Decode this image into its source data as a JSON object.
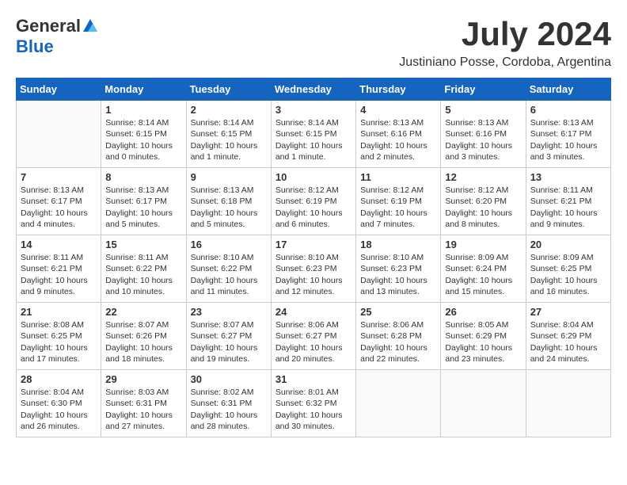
{
  "logo": {
    "general": "General",
    "blue": "Blue"
  },
  "title": {
    "month_year": "July 2024",
    "location": "Justiniano Posse, Cordoba, Argentina"
  },
  "weekdays": [
    "Sunday",
    "Monday",
    "Tuesday",
    "Wednesday",
    "Thursday",
    "Friday",
    "Saturday"
  ],
  "weeks": [
    [
      {
        "day": "",
        "info": ""
      },
      {
        "day": "1",
        "info": "Sunrise: 8:14 AM\nSunset: 6:15 PM\nDaylight: 10 hours\nand 0 minutes."
      },
      {
        "day": "2",
        "info": "Sunrise: 8:14 AM\nSunset: 6:15 PM\nDaylight: 10 hours\nand 1 minute."
      },
      {
        "day": "3",
        "info": "Sunrise: 8:14 AM\nSunset: 6:15 PM\nDaylight: 10 hours\nand 1 minute."
      },
      {
        "day": "4",
        "info": "Sunrise: 8:13 AM\nSunset: 6:16 PM\nDaylight: 10 hours\nand 2 minutes."
      },
      {
        "day": "5",
        "info": "Sunrise: 8:13 AM\nSunset: 6:16 PM\nDaylight: 10 hours\nand 3 minutes."
      },
      {
        "day": "6",
        "info": "Sunrise: 8:13 AM\nSunset: 6:17 PM\nDaylight: 10 hours\nand 3 minutes."
      }
    ],
    [
      {
        "day": "7",
        "info": "Sunrise: 8:13 AM\nSunset: 6:17 PM\nDaylight: 10 hours\nand 4 minutes."
      },
      {
        "day": "8",
        "info": "Sunrise: 8:13 AM\nSunset: 6:17 PM\nDaylight: 10 hours\nand 5 minutes."
      },
      {
        "day": "9",
        "info": "Sunrise: 8:13 AM\nSunset: 6:18 PM\nDaylight: 10 hours\nand 5 minutes."
      },
      {
        "day": "10",
        "info": "Sunrise: 8:12 AM\nSunset: 6:19 PM\nDaylight: 10 hours\nand 6 minutes."
      },
      {
        "day": "11",
        "info": "Sunrise: 8:12 AM\nSunset: 6:19 PM\nDaylight: 10 hours\nand 7 minutes."
      },
      {
        "day": "12",
        "info": "Sunrise: 8:12 AM\nSunset: 6:20 PM\nDaylight: 10 hours\nand 8 minutes."
      },
      {
        "day": "13",
        "info": "Sunrise: 8:11 AM\nSunset: 6:21 PM\nDaylight: 10 hours\nand 9 minutes."
      }
    ],
    [
      {
        "day": "14",
        "info": "Sunrise: 8:11 AM\nSunset: 6:21 PM\nDaylight: 10 hours\nand 9 minutes."
      },
      {
        "day": "15",
        "info": "Sunrise: 8:11 AM\nSunset: 6:22 PM\nDaylight: 10 hours\nand 10 minutes."
      },
      {
        "day": "16",
        "info": "Sunrise: 8:10 AM\nSunset: 6:22 PM\nDaylight: 10 hours\nand 11 minutes."
      },
      {
        "day": "17",
        "info": "Sunrise: 8:10 AM\nSunset: 6:23 PM\nDaylight: 10 hours\nand 12 minutes."
      },
      {
        "day": "18",
        "info": "Sunrise: 8:10 AM\nSunset: 6:23 PM\nDaylight: 10 hours\nand 13 minutes."
      },
      {
        "day": "19",
        "info": "Sunrise: 8:09 AM\nSunset: 6:24 PM\nDaylight: 10 hours\nand 15 minutes."
      },
      {
        "day": "20",
        "info": "Sunrise: 8:09 AM\nSunset: 6:25 PM\nDaylight: 10 hours\nand 16 minutes."
      }
    ],
    [
      {
        "day": "21",
        "info": "Sunrise: 8:08 AM\nSunset: 6:25 PM\nDaylight: 10 hours\nand 17 minutes."
      },
      {
        "day": "22",
        "info": "Sunrise: 8:07 AM\nSunset: 6:26 PM\nDaylight: 10 hours\nand 18 minutes."
      },
      {
        "day": "23",
        "info": "Sunrise: 8:07 AM\nSunset: 6:27 PM\nDaylight: 10 hours\nand 19 minutes."
      },
      {
        "day": "24",
        "info": "Sunrise: 8:06 AM\nSunset: 6:27 PM\nDaylight: 10 hours\nand 20 minutes."
      },
      {
        "day": "25",
        "info": "Sunrise: 8:06 AM\nSunset: 6:28 PM\nDaylight: 10 hours\nand 22 minutes."
      },
      {
        "day": "26",
        "info": "Sunrise: 8:05 AM\nSunset: 6:29 PM\nDaylight: 10 hours\nand 23 minutes."
      },
      {
        "day": "27",
        "info": "Sunrise: 8:04 AM\nSunset: 6:29 PM\nDaylight: 10 hours\nand 24 minutes."
      }
    ],
    [
      {
        "day": "28",
        "info": "Sunrise: 8:04 AM\nSunset: 6:30 PM\nDaylight: 10 hours\nand 26 minutes."
      },
      {
        "day": "29",
        "info": "Sunrise: 8:03 AM\nSunset: 6:31 PM\nDaylight: 10 hours\nand 27 minutes."
      },
      {
        "day": "30",
        "info": "Sunrise: 8:02 AM\nSunset: 6:31 PM\nDaylight: 10 hours\nand 28 minutes."
      },
      {
        "day": "31",
        "info": "Sunrise: 8:01 AM\nSunset: 6:32 PM\nDaylight: 10 hours\nand 30 minutes."
      },
      {
        "day": "",
        "info": ""
      },
      {
        "day": "",
        "info": ""
      },
      {
        "day": "",
        "info": ""
      }
    ]
  ]
}
